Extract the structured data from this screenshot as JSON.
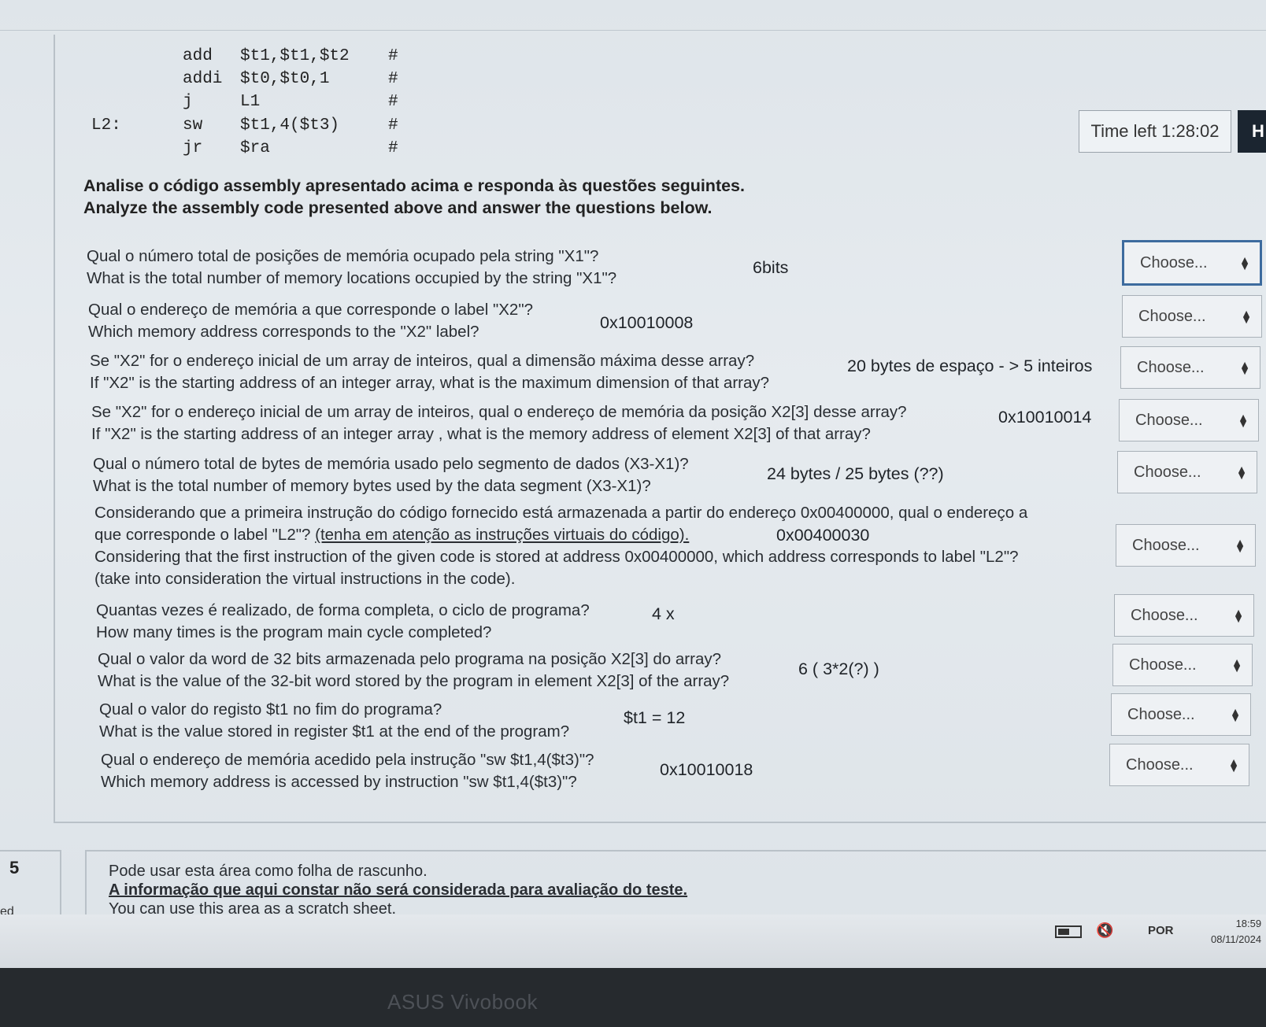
{
  "code": {
    "lines": [
      {
        "label": "",
        "op": "add",
        "args": "$t1,$t1,$t2",
        "comment": "#"
      },
      {
        "label": "",
        "op": "addi",
        "args": "$t0,$t0,1",
        "comment": "#"
      },
      {
        "label": "",
        "op": "j",
        "args": "L1",
        "comment": "#"
      },
      {
        "label": "L2:",
        "op": "sw",
        "args": "$t1,4($t3)",
        "comment": "#"
      },
      {
        "label": "",
        "op": "jr",
        "args": "$ra",
        "comment": "#"
      }
    ]
  },
  "timer": {
    "text": "Time left 1:28:02",
    "side_letter": "H"
  },
  "intro": {
    "pt": "Analise o código assembly apresentado acima e responda às questões seguintes.",
    "en": "Analyze the assembly code presented above and answer the questions below."
  },
  "select_placeholder": "Choose...",
  "questions": [
    {
      "pt": "Qual o número total de posições de memória ocupado pela string \"X1\"?",
      "en": "What is the total number of memory locations occupied by the string \"X1\"?",
      "note": "6bits"
    },
    {
      "pt": "Qual o endereço de memória a que corresponde o label \"X2\"?",
      "en": "Which memory address corresponds to the \"X2\" label?",
      "note": "0x10010008"
    },
    {
      "pt": "Se \"X2\" for o endereço inicial de um array de inteiros, qual a dimensão máxima desse array?",
      "en": "If \"X2\" is the starting address of an integer array, what is the maximum dimension of that array?",
      "note": "20 bytes de espaço - > 5 inteiros"
    },
    {
      "pt": "Se \"X2\" for o endereço inicial de um array de inteiros, qual o endereço de memória da posição X2[3] desse array?",
      "en": "If \"X2\" is the starting address of an integer array , what is the memory address of element X2[3] of that array?",
      "note": "0x10010014"
    },
    {
      "pt": "Qual o número total de bytes de memória usado pelo segmento de dados (X3-X1)?",
      "en": "What is the total number of memory bytes used by the data segment (X3-X1)?",
      "note": "24 bytes / 25 bytes (??)"
    },
    {
      "pt": "Considerando que a primeira instrução do código fornecido está armazenada a partir do endereço 0x00400000, qual o endereço a",
      "pt2": "que corresponde o label \"L2\"?",
      "pt_link": "(tenha em atenção as instruções virtuais do código).",
      "en": "Considering that the first instruction of the given code is stored at address 0x00400000, which address corresponds to label \"L2\"?",
      "en2": "(take into consideration the virtual instructions in the code).",
      "note": "0x00400030"
    },
    {
      "pt": "Quantas vezes é realizado, de forma completa, o ciclo de programa?",
      "en": "How many times is the program main cycle completed?",
      "note": "4 x"
    },
    {
      "pt": "Qual o valor da word de 32 bits armazenada pelo programa na posição X2[3] do array?",
      "en": "What is the value of the 32-bit word stored by the program in element X2[3] of the array?",
      "note": "6 ( 3*2(?) )"
    },
    {
      "pt": "Qual o valor do registo $t1 no fim do programa?",
      "en": "What is the value stored in register $t1 at the end of the program?",
      "note": "$t1 = 12"
    },
    {
      "pt": "Qual o endereço de memória acedido pela instrução \"sw $t1,4($t3)\"?",
      "en": "Which memory address is accessed by instruction \"sw $t1,4($t3)\"?",
      "note": "0x10010018"
    }
  ],
  "scratch": {
    "number": "5",
    "status": "ed",
    "line1": "Pode usar esta área como folha de rascunho.",
    "line2": "A informação que aqui constar não será considerada para avaliação do teste.",
    "line3": "You can use this area as a scratch sheet."
  },
  "taskbar": {
    "lang": "POR",
    "time": "18:59",
    "date": "08/11/2024"
  },
  "brand": "ASUS Vivobook"
}
